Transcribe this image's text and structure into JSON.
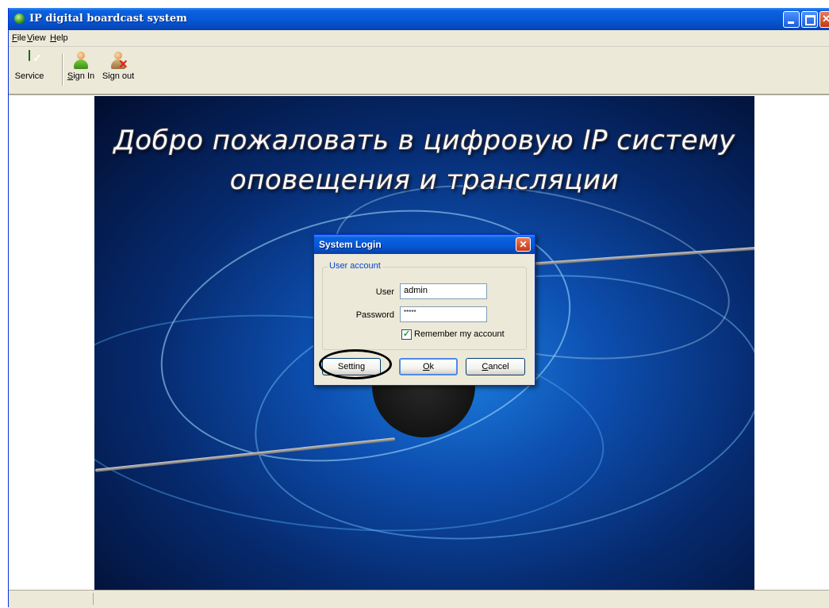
{
  "window": {
    "title": "IP digital boardcast system"
  },
  "menu": {
    "items": [
      {
        "hot": "F",
        "rest": "ile"
      },
      {
        "hot": "V",
        "rest": "iew"
      },
      {
        "hot": "H",
        "rest": "elp"
      }
    ]
  },
  "toolbar": {
    "service": {
      "label": "Service",
      "icon": "shield-icon"
    },
    "sign_in": {
      "hot": "S",
      "rest": "ign In",
      "icon": "user-icon"
    },
    "sign_out": {
      "label": "Sign out",
      "icon": "user-remove-icon"
    }
  },
  "splash": {
    "welcome_line1": "Добро пожаловать в цифровую IP систему",
    "welcome_line2": "оповещения и трансляции"
  },
  "dialog": {
    "title": "System Login",
    "group_label": "User account",
    "user_label": "User",
    "user_value": "admin",
    "password_label": "Password",
    "password_value": "*****",
    "remember_label": "Remember my account",
    "remember_checked": true,
    "setting_label": "Setting",
    "ok_hot": "O",
    "ok_rest": "k",
    "cancel_hot": "C",
    "cancel_rest": "ancel"
  },
  "colors": {
    "title_bar": "#0a62e0",
    "dialog_face": "#ece9d8",
    "highlight_oval": "#000000"
  }
}
